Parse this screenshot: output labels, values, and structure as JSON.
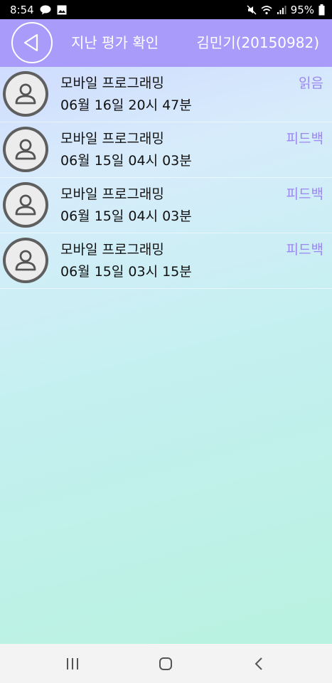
{
  "status_bar": {
    "time": "8:54",
    "battery": "95%",
    "icons": [
      "chat-bubble-icon",
      "image-icon",
      "mute-icon",
      "wifi-icon",
      "signal-icon",
      "battery-icon"
    ]
  },
  "header": {
    "title": "지난 평가 확인",
    "user": "김민기(20150982)",
    "back_icon": "back-triangle-icon"
  },
  "colors": {
    "header_bg": "#a99bfa",
    "status_accent": "#9b86f2"
  },
  "list": {
    "items": [
      {
        "title": "모바일 프로그래밍",
        "date": "06월 16일 20시 47분",
        "status": "읽음"
      },
      {
        "title": "모바일 프로그래밍",
        "date": "06월 15일 04시 03분",
        "status": "피드백"
      },
      {
        "title": "모바일 프로그래밍",
        "date": "06월 15일 04시 03분",
        "status": "피드백"
      },
      {
        "title": "모바일 프로그래밍",
        "date": "06월 15일 03시 15분",
        "status": "피드백"
      }
    ]
  },
  "nav_bar": {
    "buttons": [
      "recent-apps-icon",
      "home-icon",
      "back-chevron-icon"
    ]
  }
}
